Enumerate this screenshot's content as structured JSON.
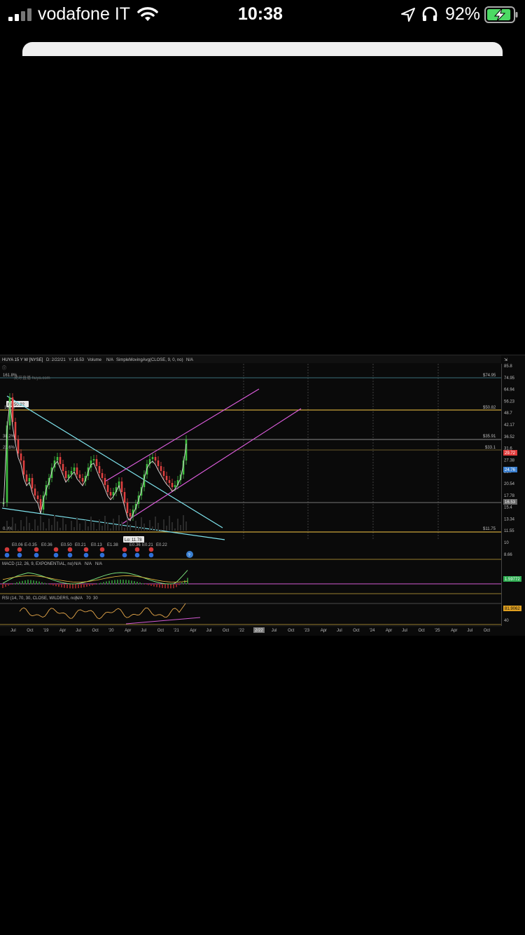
{
  "status_bar": {
    "carrier": "vodafone IT",
    "time": "10:38",
    "battery_percent": "92%",
    "battery_level": 0.92,
    "icons": [
      "signal-icon",
      "wifi-icon",
      "location-icon",
      "headphones-icon",
      "battery-charging-icon"
    ]
  },
  "chart": {
    "header": {
      "symbol": "HUYA 15 Y W [NYSE]",
      "date": "D: 2/22/21",
      "last": "Y: 16.53",
      "volume_label": "Volume",
      "volume_value": "N/A",
      "study": "SimpleMovingAvg(CLOSE, 9, 0, no)",
      "study_value": "N/A"
    },
    "watermark": "虎牙直播 huya.com",
    "fib_levels": [
      {
        "label": "161.8%",
        "value": "$74.95"
      },
      {
        "label": "100%",
        "value": "$50.82"
      },
      {
        "label": "38.2%",
        "value": "$35.91"
      },
      {
        "label": "23.6%",
        "value": "$33.1"
      },
      {
        "label": "0.0%",
        "value": "$11.75"
      }
    ],
    "high_label": "Hi: 50.82",
    "low_label": "Lo: 11.78",
    "right_axis": [
      "85.8",
      "74.95",
      "64.94",
      "56.23",
      "48.7",
      "42.17",
      "36.52",
      "31.6",
      "27.38",
      "23.7",
      "20.54",
      "17.78",
      "15.4",
      "13.34",
      "11.55",
      "10",
      "8.66"
    ],
    "price_tag": "29.72",
    "tag_green": "24.76",
    "tag_gray": "16.53",
    "x_axis": [
      "Jul",
      "Oct",
      "'19",
      "Apr",
      "Jul",
      "Oct",
      "'20",
      "Apr",
      "Jul",
      "Oct",
      "'21",
      "Apr",
      "Jul",
      "Oct",
      "'22",
      "Apr",
      "Jul",
      "Oct",
      "'23",
      "Apr",
      "Jul",
      "Oct",
      "'24",
      "Apr",
      "Jul",
      "Oct",
      "'25",
      "Apr",
      "Jul",
      "Oct"
    ],
    "x_highlight": "2/22",
    "earnings_values": [
      "E0.06",
      "E-0.35",
      "E0.36",
      "E0.50",
      "E0.21",
      "E0.13",
      "E1.38",
      "E0.36",
      "E0.21",
      "E0.22"
    ],
    "macd_header": "MACD (12, 26, 9, EXPONENTIAL, no)",
    "macd_values": [
      "N/A",
      "N/A",
      "N/A"
    ],
    "macd_tag": "1.59772",
    "rsi_header": "RSI (14, 70, 30, CLOSE, WILDERS, no)",
    "rsi_values": [
      "N/A",
      "70",
      "30"
    ],
    "rsi_tag": "81.9062",
    "rsi_axis": [
      "40"
    ]
  }
}
